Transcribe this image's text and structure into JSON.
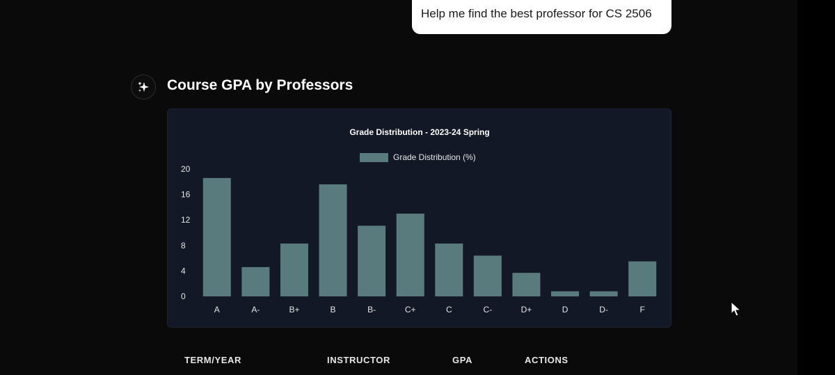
{
  "chat": {
    "user_message": "Help me find the best professor for CS 2506",
    "section_title": "Course GPA by Professors",
    "avatar_icon": "sparkles-icon"
  },
  "colors": {
    "bar": "#5a7b7e",
    "card_bg": "#131826",
    "page_bg": "#0a0a0a"
  },
  "chart_data": {
    "type": "bar",
    "title": "Grade Distribution - 2023-24 Spring",
    "categories": [
      "A",
      "A-",
      "B+",
      "B",
      "B-",
      "C+",
      "C",
      "C-",
      "D+",
      "D",
      "D-",
      "F"
    ],
    "series": [
      {
        "name": "Grade Distribution (%)",
        "values": [
          18.6,
          4.6,
          8.3,
          17.6,
          11.1,
          13.0,
          8.3,
          6.4,
          3.7,
          0.8,
          0.8,
          5.5
        ]
      }
    ],
    "yticks": [
      "0",
      "4",
      "8",
      "12",
      "16",
      "20"
    ],
    "ylim": [
      0,
      20
    ],
    "grid": false,
    "legend": "top-center"
  },
  "table": {
    "columns": [
      "TERM/YEAR",
      "INSTRUCTOR",
      "GPA",
      "ACTIONS"
    ]
  }
}
